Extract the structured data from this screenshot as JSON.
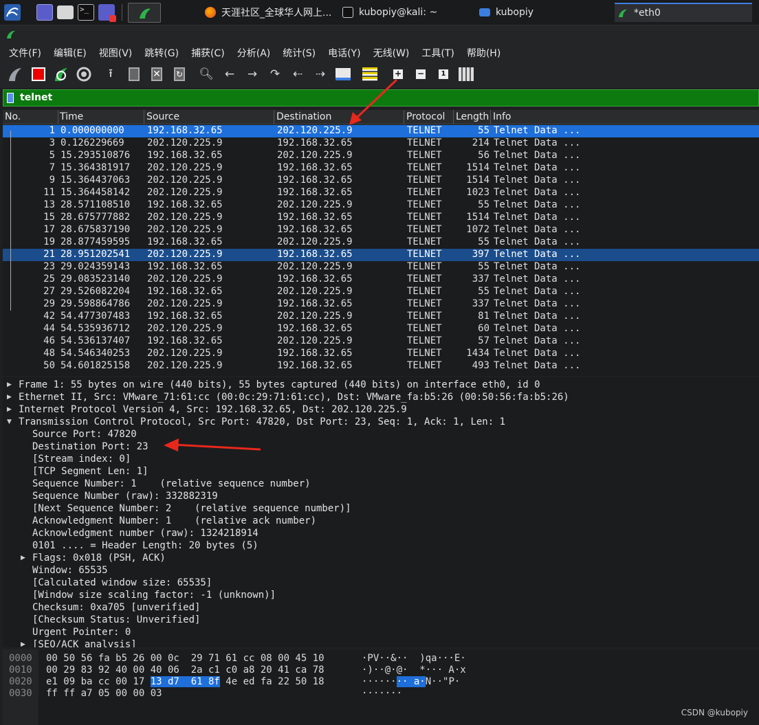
{
  "taskbar": {
    "tasks": [
      {
        "label": "天涯社区_全球华人网上...",
        "icon": "firefox-icon"
      },
      {
        "label": "kubopiy@kali: ~",
        "icon": "terminal-icon"
      },
      {
        "label": "kubopiy",
        "icon": "folder-icon"
      },
      {
        "label": "*eth0",
        "icon": "wireshark-icon"
      }
    ]
  },
  "menu": [
    "文件(F)",
    "编辑(E)",
    "视图(V)",
    "跳转(G)",
    "捕获(C)",
    "分析(A)",
    "统计(S)",
    "电话(Y)",
    "无线(W)",
    "工具(T)",
    "帮助(H)"
  ],
  "filter": {
    "value": "telnet"
  },
  "columns": [
    "No.",
    "Time",
    "Source",
    "Destination",
    "Protocol",
    "Length",
    "Info"
  ],
  "packets": [
    {
      "no": "1",
      "time": "0.000000000",
      "src": "192.168.32.65",
      "dst": "202.120.225.9",
      "proto": "TELNET",
      "len": "55",
      "info": "Telnet Data ..."
    },
    {
      "no": "3",
      "time": "0.126229669",
      "src": "202.120.225.9",
      "dst": "192.168.32.65",
      "proto": "TELNET",
      "len": "214",
      "info": "Telnet Data ..."
    },
    {
      "no": "5",
      "time": "15.293510876",
      "src": "192.168.32.65",
      "dst": "202.120.225.9",
      "proto": "TELNET",
      "len": "56",
      "info": "Telnet Data ..."
    },
    {
      "no": "7",
      "time": "15.364381917",
      "src": "202.120.225.9",
      "dst": "192.168.32.65",
      "proto": "TELNET",
      "len": "1514",
      "info": "Telnet Data ..."
    },
    {
      "no": "9",
      "time": "15.364437063",
      "src": "202.120.225.9",
      "dst": "192.168.32.65",
      "proto": "TELNET",
      "len": "1514",
      "info": "Telnet Data ..."
    },
    {
      "no": "11",
      "time": "15.364458142",
      "src": "202.120.225.9",
      "dst": "192.168.32.65",
      "proto": "TELNET",
      "len": "1023",
      "info": "Telnet Data ..."
    },
    {
      "no": "13",
      "time": "28.571108510",
      "src": "192.168.32.65",
      "dst": "202.120.225.9",
      "proto": "TELNET",
      "len": "55",
      "info": "Telnet Data ..."
    },
    {
      "no": "15",
      "time": "28.675777882",
      "src": "202.120.225.9",
      "dst": "192.168.32.65",
      "proto": "TELNET",
      "len": "1514",
      "info": "Telnet Data ..."
    },
    {
      "no": "17",
      "time": "28.675837190",
      "src": "202.120.225.9",
      "dst": "192.168.32.65",
      "proto": "TELNET",
      "len": "1072",
      "info": "Telnet Data ..."
    },
    {
      "no": "19",
      "time": "28.877459595",
      "src": "192.168.32.65",
      "dst": "202.120.225.9",
      "proto": "TELNET",
      "len": "55",
      "info": "Telnet Data ..."
    },
    {
      "no": "21",
      "time": "28.951202541",
      "src": "202.120.225.9",
      "dst": "192.168.32.65",
      "proto": "TELNET",
      "len": "397",
      "info": "Telnet Data ..."
    },
    {
      "no": "23",
      "time": "29.024359143",
      "src": "192.168.32.65",
      "dst": "202.120.225.9",
      "proto": "TELNET",
      "len": "55",
      "info": "Telnet Data ..."
    },
    {
      "no": "25",
      "time": "29.083523140",
      "src": "202.120.225.9",
      "dst": "192.168.32.65",
      "proto": "TELNET",
      "len": "337",
      "info": "Telnet Data ..."
    },
    {
      "no": "27",
      "time": "29.526082204",
      "src": "192.168.32.65",
      "dst": "202.120.225.9",
      "proto": "TELNET",
      "len": "55",
      "info": "Telnet Data ..."
    },
    {
      "no": "29",
      "time": "29.598864786",
      "src": "202.120.225.9",
      "dst": "192.168.32.65",
      "proto": "TELNET",
      "len": "337",
      "info": "Telnet Data ..."
    },
    {
      "no": "42",
      "time": "54.477307483",
      "src": "192.168.32.65",
      "dst": "202.120.225.9",
      "proto": "TELNET",
      "len": "81",
      "info": "Telnet Data ..."
    },
    {
      "no": "44",
      "time": "54.535936712",
      "src": "202.120.225.9",
      "dst": "192.168.32.65",
      "proto": "TELNET",
      "len": "60",
      "info": "Telnet Data ..."
    },
    {
      "no": "46",
      "time": "54.536137407",
      "src": "192.168.32.65",
      "dst": "202.120.225.9",
      "proto": "TELNET",
      "len": "57",
      "info": "Telnet Data ..."
    },
    {
      "no": "48",
      "time": "54.546340253",
      "src": "202.120.225.9",
      "dst": "192.168.32.65",
      "proto": "TELNET",
      "len": "1434",
      "info": "Telnet Data ..."
    },
    {
      "no": "50",
      "time": "54.601825158",
      "src": "202.120.225.9",
      "dst": "192.168.32.65",
      "proto": "TELNET",
      "len": "493",
      "info": "Telnet Data ..."
    }
  ],
  "details": [
    {
      "text": "Frame 1: 55 bytes on wire (440 bits), 55 bytes captured (440 bits) on interface eth0, id 0",
      "indent": 0,
      "toggle": "collapsed"
    },
    {
      "text": "Ethernet II, Src: VMware_71:61:cc (00:0c:29:71:61:cc), Dst: VMware_fa:b5:26 (00:50:56:fa:b5:26)",
      "indent": 0,
      "toggle": "collapsed"
    },
    {
      "text": "Internet Protocol Version 4, Src: 192.168.32.65, Dst: 202.120.225.9",
      "indent": 0,
      "toggle": "collapsed"
    },
    {
      "text": "Transmission Control Protocol, Src Port: 47820, Dst Port: 23, Seq: 1, Ack: 1, Len: 1",
      "indent": 0,
      "toggle": "expanded"
    },
    {
      "text": "Source Port: 47820",
      "indent": 1,
      "toggle": ""
    },
    {
      "text": "Destination Port: 23",
      "indent": 1,
      "toggle": ""
    },
    {
      "text": "[Stream index: 0]",
      "indent": 1,
      "toggle": ""
    },
    {
      "text": "[TCP Segment Len: 1]",
      "indent": 1,
      "toggle": ""
    },
    {
      "text": "Sequence Number: 1    (relative sequence number)",
      "indent": 1,
      "toggle": ""
    },
    {
      "text": "Sequence Number (raw): 332882319",
      "indent": 1,
      "toggle": ""
    },
    {
      "text": "[Next Sequence Number: 2    (relative sequence number)]",
      "indent": 1,
      "toggle": ""
    },
    {
      "text": "Acknowledgment Number: 1    (relative ack number)",
      "indent": 1,
      "toggle": ""
    },
    {
      "text": "Acknowledgment number (raw): 1324218914",
      "indent": 1,
      "toggle": ""
    },
    {
      "text": "0101 .... = Header Length: 20 bytes (5)",
      "indent": 1,
      "toggle": ""
    },
    {
      "text": "Flags: 0x018 (PSH, ACK)",
      "indent": 1,
      "toggle": "collapsed"
    },
    {
      "text": "Window: 65535",
      "indent": 1,
      "toggle": ""
    },
    {
      "text": "[Calculated window size: 65535]",
      "indent": 1,
      "toggle": ""
    },
    {
      "text": "[Window size scaling factor: -1 (unknown)]",
      "indent": 1,
      "toggle": ""
    },
    {
      "text": "Checksum: 0xa705 [unverified]",
      "indent": 1,
      "toggle": ""
    },
    {
      "text": "[Checksum Status: Unverified]",
      "indent": 1,
      "toggle": ""
    },
    {
      "text": "Urgent Pointer: 0",
      "indent": 1,
      "toggle": ""
    },
    {
      "text": "[SEQ/ACK analysis]",
      "indent": 1,
      "toggle": "collapsed"
    }
  ],
  "hex": [
    {
      "off": "0000",
      "pre": "00 50 56 fa b5 26 00 0c  29 71 61 cc 08 00 45 10",
      "hl": "",
      "post": "",
      "ascii_pre": "·PV··&··  )qa···E·",
      "ascii_hl": "",
      "ascii_post": ""
    },
    {
      "off": "0010",
      "pre": "00 29 83 92 40 00 40 06  2a c1 c0 a8 20 41 ca 78",
      "hl": "",
      "post": "",
      "ascii_pre": "·)··@·@·  *··· A·x",
      "ascii_hl": "",
      "ascii_post": ""
    },
    {
      "off": "0020",
      "pre": "e1 09 ba cc 00 17 ",
      "hl": "13 d7  61 8f",
      "post": " 4e ed fa 22 50 18",
      "ascii_pre": "······",
      "ascii_hl": "·· a·",
      "ascii_post": "N··\"P·"
    },
    {
      "off": "0030",
      "pre": "ff ff a7 05 00 00 03",
      "hl": "",
      "post": "",
      "ascii_pre": "·······",
      "ascii_hl": "",
      "ascii_post": ""
    }
  ],
  "watermark": "CSDN @kubopiy",
  "colors": {
    "selected_row": "#1e6fd9",
    "selected_row_alt": "#1b4d8c",
    "filter_bg": "#0d7a10",
    "arrow": "#e8281c"
  }
}
